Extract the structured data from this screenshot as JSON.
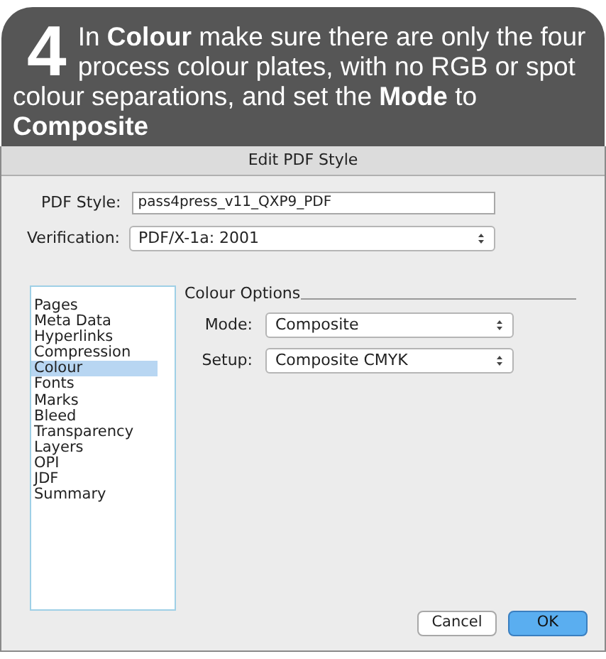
{
  "step": {
    "number": "4",
    "text": "In **Colour** make sure there are only the four process colour plates, with no RGB or spot colour separations, and set the **Mode** to **Composite**"
  },
  "window": {
    "title": "Edit PDF Style"
  },
  "pdf_style": {
    "label": "PDF Style:",
    "value": "pass4press_v11_QXP9_PDF"
  },
  "verification": {
    "label": "Verification:",
    "value": "PDF/X-1a: 2001"
  },
  "sidebar": {
    "items": [
      {
        "label": "Pages",
        "selected": false
      },
      {
        "label": "Meta Data",
        "selected": false
      },
      {
        "label": "Hyperlinks",
        "selected": false
      },
      {
        "label": "Compression",
        "selected": false
      },
      {
        "label": "Colour",
        "selected": true
      },
      {
        "label": "Fonts",
        "selected": false
      },
      {
        "label": "Marks",
        "selected": false
      },
      {
        "label": "Bleed",
        "selected": false
      },
      {
        "label": "Transparency",
        "selected": false
      },
      {
        "label": "Layers",
        "selected": false
      },
      {
        "label": "OPI",
        "selected": false
      },
      {
        "label": "JDF",
        "selected": false
      },
      {
        "label": "Summary",
        "selected": false
      }
    ]
  },
  "colour_options": {
    "title": "Colour Options",
    "fields": [
      {
        "label": "Mode:",
        "value": "Composite"
      },
      {
        "label": "Setup:",
        "value": "Composite CMYK"
      }
    ]
  },
  "buttons": [
    {
      "label": "Cancel",
      "kind": "secondary"
    },
    {
      "label": "OK",
      "kind": "primary"
    }
  ]
}
